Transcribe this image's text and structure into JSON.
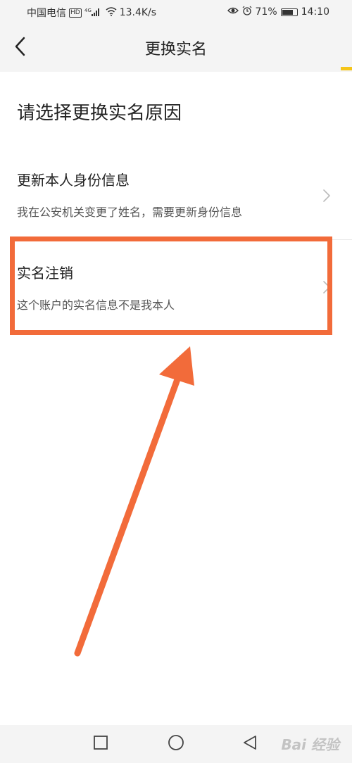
{
  "status_bar": {
    "carrier": "中国电信",
    "hd": "HD",
    "network": "4G",
    "speed": "13.4K/s",
    "battery": "71%",
    "battery_level": 0.71,
    "time": "14:10"
  },
  "nav": {
    "title": "更换实名"
  },
  "heading": "请选择更换实名原因",
  "options": [
    {
      "title": "更新本人身份信息",
      "desc": "我在公安机关变更了姓名，需要更新身份信息"
    },
    {
      "title": "实名注销",
      "desc": "这个账户的实名信息不是我本人"
    }
  ],
  "annotation_color": "#f26b3a",
  "accent_color": "#f5c518",
  "watermark": "Bai 经验"
}
